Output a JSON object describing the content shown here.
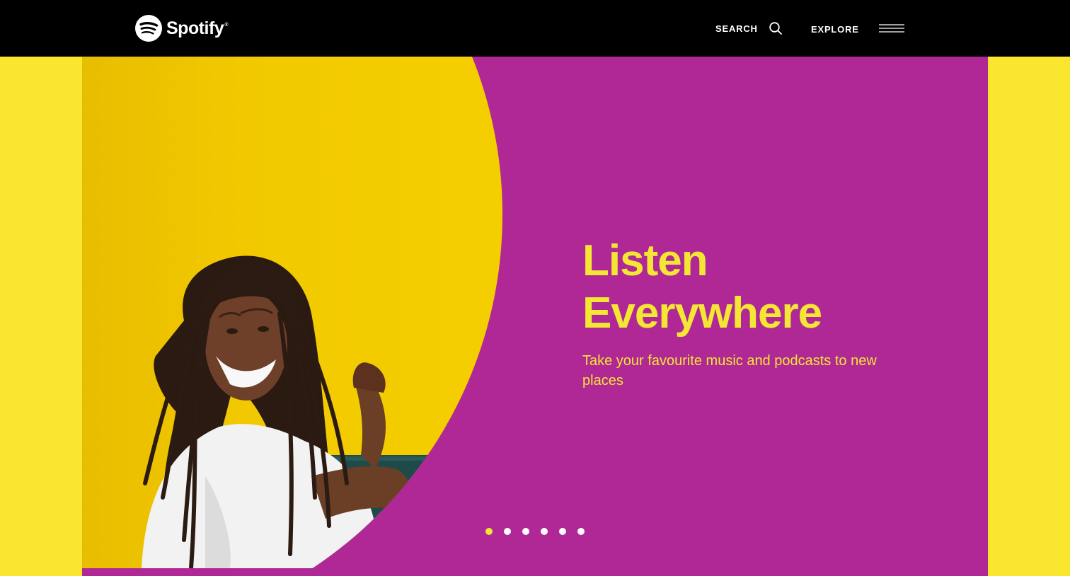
{
  "brand": {
    "name": "Spotify",
    "registered_mark": "®",
    "logo_icon": "spotify-logo-icon"
  },
  "nav": {
    "search_label": "SEARCH",
    "search_icon": "search-icon",
    "explore_label": "EXPLORE",
    "menu_icon": "hamburger-menu-icon"
  },
  "hero": {
    "title_line1": "Listen",
    "title_line2": "Everywhere",
    "subtitle": "Take your favourite music and podcasts to new places",
    "image_icon": "smiling-man-photo",
    "active_slide": 1,
    "slide_count": 6
  },
  "colors": {
    "page_background": "#fbe62f",
    "header_background": "#000000",
    "hero_background": "#af2896",
    "hero_text": "#f4e734",
    "photo_backdrop": "#f0c800",
    "active_dot": "#f4e734",
    "inactive_dot": "#ffffff"
  }
}
